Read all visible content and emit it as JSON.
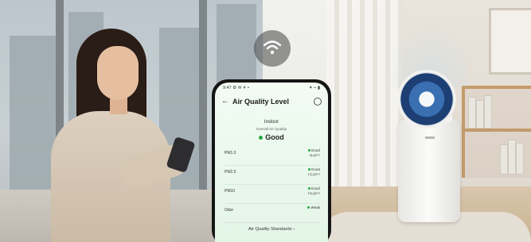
{
  "phone": {
    "status_time": "9:47",
    "status_icons": "⚙ ✉ ✈ •",
    "status_right": "✦ ⌁ ▮",
    "app_title": "Air Quality Level",
    "section": "Indoor",
    "overall_label": "Overall Air Quality",
    "overall_value": "Good",
    "readings": [
      {
        "name": "PM1.0",
        "status": "Good",
        "value": "8μg/m³"
      },
      {
        "name": "PM2.5",
        "status": "Good",
        "value": "12μg/m³"
      },
      {
        "name": "PM10",
        "status": "Good",
        "value": "15μg/m³"
      },
      {
        "name": "Odor",
        "status": "Weak",
        "value": ""
      }
    ],
    "standards_link": "Air Quality Standards  ›"
  },
  "colors": {
    "good": "#28a745",
    "screen_bg": "#e3f5e6"
  },
  "icons": {
    "wifi": "wifi-icon",
    "back": "back-arrow-icon",
    "history": "history-icon"
  }
}
